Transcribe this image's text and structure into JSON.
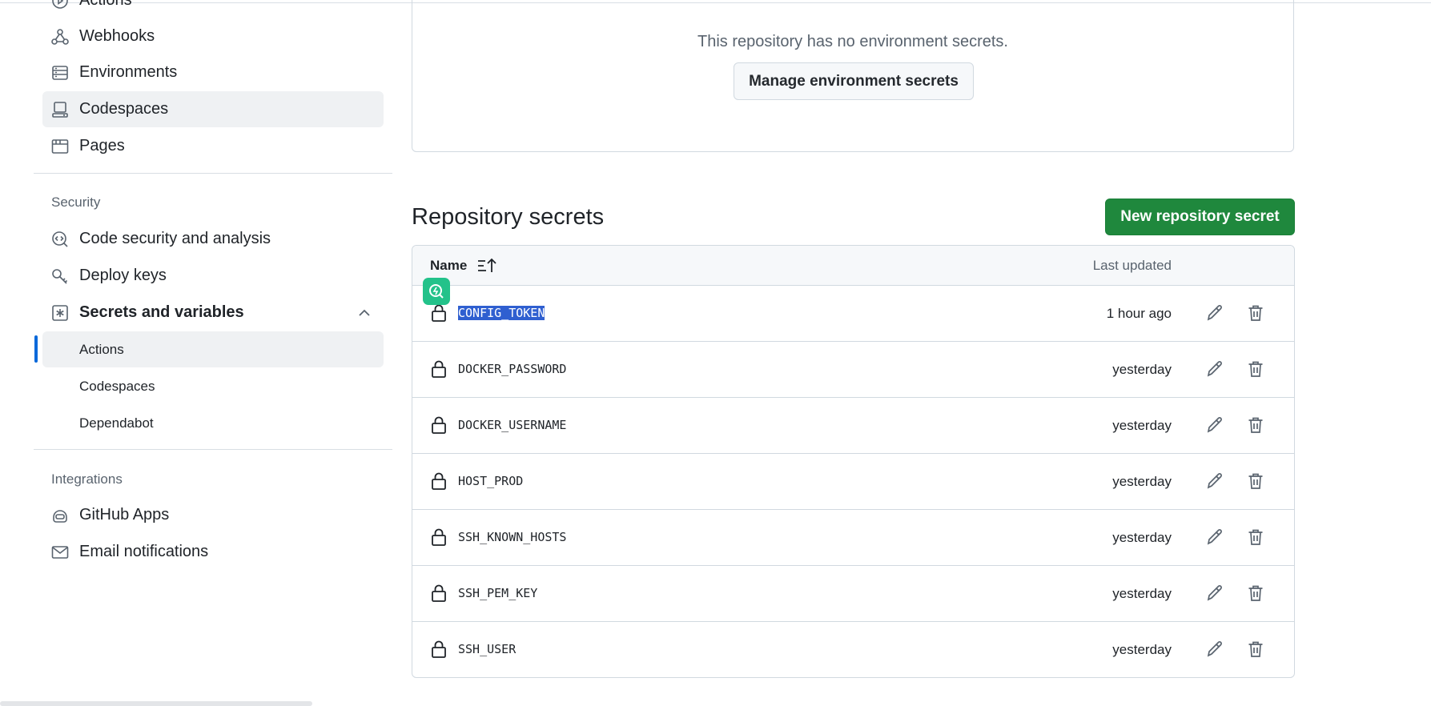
{
  "sidebar": {
    "top_items": [
      {
        "label": "Actions",
        "icon": "play-icon"
      },
      {
        "label": "Webhooks",
        "icon": "webhook-icon"
      },
      {
        "label": "Environments",
        "icon": "server-icon"
      },
      {
        "label": "Codespaces",
        "icon": "codespaces-icon"
      },
      {
        "label": "Pages",
        "icon": "browser-icon"
      }
    ],
    "security_heading": "Security",
    "security_items": [
      {
        "label": "Code security and analysis",
        "icon": "codescan-icon"
      },
      {
        "label": "Deploy keys",
        "icon": "key-icon"
      },
      {
        "label": "Secrets and variables",
        "icon": "key-asterisk-icon"
      }
    ],
    "secrets_subitems": [
      "Actions",
      "Codespaces",
      "Dependabot"
    ],
    "integrations_heading": "Integrations",
    "integration_items": [
      {
        "label": "GitHub Apps",
        "icon": "apps-icon"
      },
      {
        "label": "Email notifications",
        "icon": "mail-icon"
      }
    ]
  },
  "environment": {
    "empty_text": "This repository has no environment secrets.",
    "manage_button": "Manage environment secrets"
  },
  "repository_secrets": {
    "title": "Repository secrets",
    "new_button": "New repository secret",
    "columns": {
      "name": "Name",
      "updated": "Last updated"
    },
    "rows": [
      {
        "name": "CONFIG_TOKEN",
        "updated": "1 hour ago"
      },
      {
        "name": "DOCKER_PASSWORD",
        "updated": "yesterday"
      },
      {
        "name": "DOCKER_USERNAME",
        "updated": "yesterday"
      },
      {
        "name": "HOST_PROD",
        "updated": "yesterday"
      },
      {
        "name": "SSH_KNOWN_HOSTS",
        "updated": "yesterday"
      },
      {
        "name": "SSH_PEM_KEY",
        "updated": "yesterday"
      },
      {
        "name": "SSH_USER",
        "updated": "yesterday"
      }
    ]
  },
  "colors": {
    "primary_green": "#1f883d",
    "accent_blue": "#0969da",
    "selection": "#2f5fd0"
  }
}
